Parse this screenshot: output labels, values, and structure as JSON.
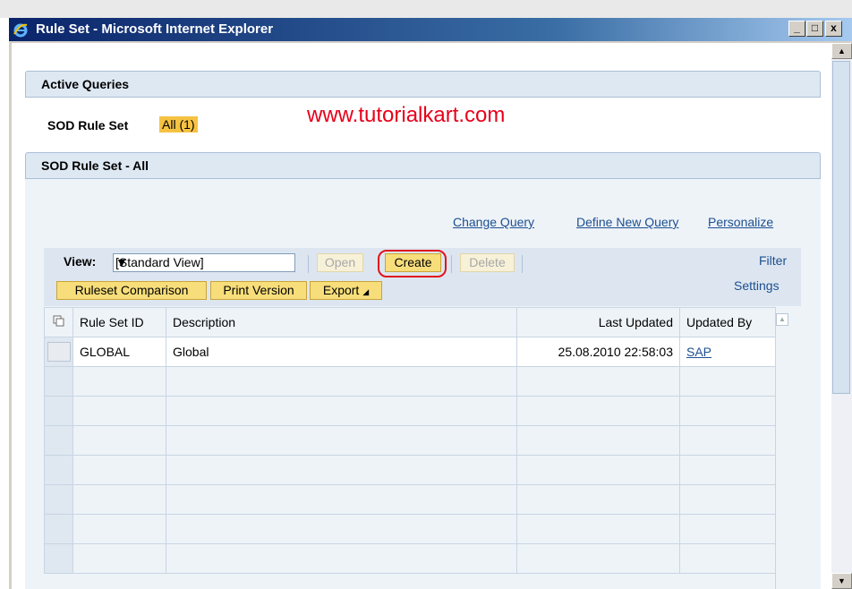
{
  "window": {
    "title": "Rule Set - Microsoft Internet Explorer",
    "controls": {
      "minimize": "_",
      "maximize": "□",
      "close": "x"
    }
  },
  "sections": {
    "active_queries": "Active Queries",
    "sod_all": "SOD Rule Set - All"
  },
  "query": {
    "label": "SOD Rule Set",
    "link": "All (1)"
  },
  "watermark": "www.tutorialkart.com",
  "query_links": {
    "change": "Change Query",
    "define": "Define New Query",
    "personalize": "Personalize"
  },
  "toolbar": {
    "view_label": "View:",
    "view_value": "[Standard View]",
    "open": "Open",
    "create": "Create",
    "delete": "Delete",
    "ruleset_comparison": "Ruleset Comparison",
    "print_version": "Print Version",
    "export": "Export",
    "filter": "Filter",
    "settings": "Settings"
  },
  "table": {
    "columns": [
      "Rule Set ID",
      "Description",
      "Last Updated",
      "Updated By"
    ],
    "rows": [
      {
        "id": "GLOBAL",
        "description": "Global",
        "last_updated": "25.08.2010 22:58:03",
        "updated_by": "SAP"
      }
    ]
  },
  "colors": {
    "highlight_ring": "#e0141e",
    "watermark": "#e8001a",
    "button_yellow": "#f8de7a",
    "section_header": "#dee8f3"
  }
}
